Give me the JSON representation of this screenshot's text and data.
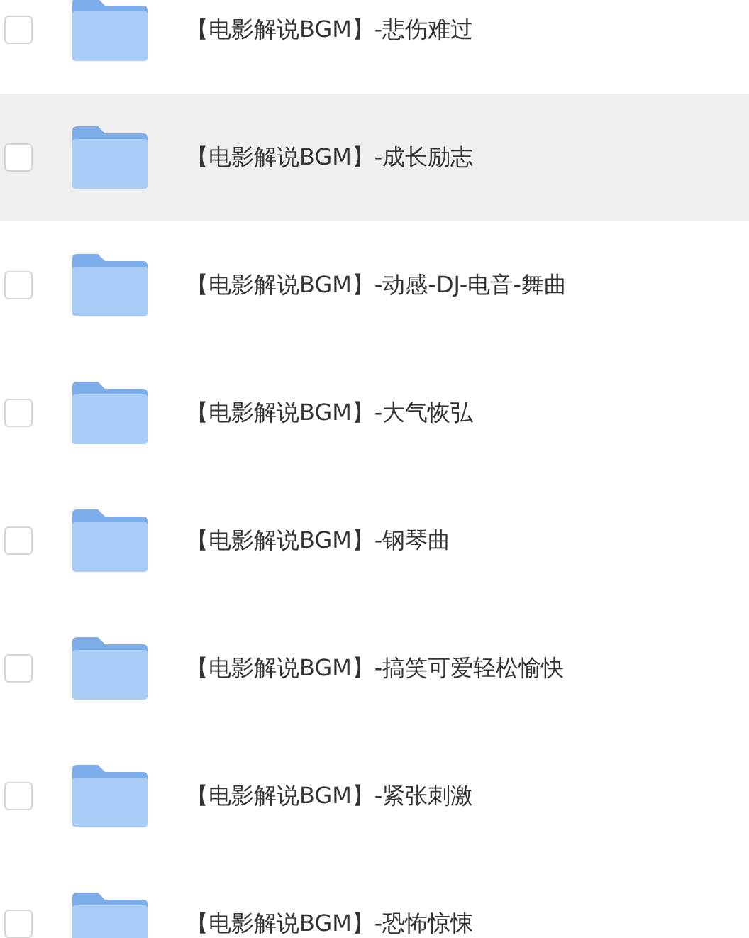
{
  "files": [
    {
      "name": "【电影解说BGM】-悲伤难过",
      "selected": false,
      "checked": false
    },
    {
      "name": "【电影解说BGM】-成长励志",
      "selected": true,
      "checked": false
    },
    {
      "name": "【电影解说BGM】-动感-DJ-电音-舞曲",
      "selected": false,
      "checked": false
    },
    {
      "name": "【电影解说BGM】-大气恢弘",
      "selected": false,
      "checked": false
    },
    {
      "name": "【电影解说BGM】-钢琴曲",
      "selected": false,
      "checked": false
    },
    {
      "name": "【电影解说BGM】-搞笑可爱轻松愉快",
      "selected": false,
      "checked": false
    },
    {
      "name": "【电影解说BGM】-紧张刺激",
      "selected": false,
      "checked": false
    },
    {
      "name": "【电影解说BGM】-恐怖惊悚",
      "selected": false,
      "checked": false
    }
  ]
}
